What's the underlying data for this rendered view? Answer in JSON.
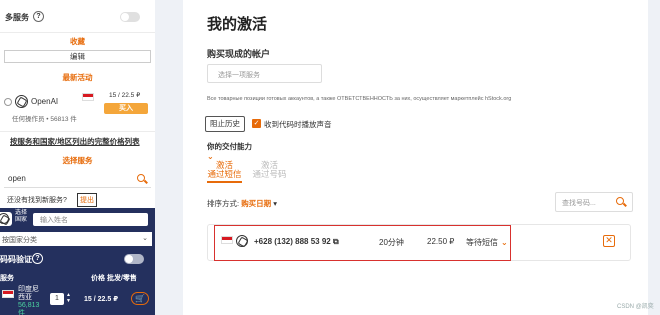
{
  "sidebar": {
    "multi_service_label": "多服务",
    "help_icon_text": "?",
    "favorites_label": "收藏",
    "edit_label": "编辑",
    "latest_activity_label": "最新活动",
    "latest_item": {
      "service": "OpenAI",
      "price_label": "15 / 22.5 ₽",
      "buy_label": "买入",
      "stock_label": "任何操作员 • 56813 件"
    },
    "full_price_link": "按服务和国家/地区列出的完整价格列表",
    "choose_service_label": "选择服务",
    "search_value": "open",
    "not_found_question": "还没有找到新服务?",
    "submit_label": "提出"
  },
  "dark_panel": {
    "small_label": "选择国家",
    "name_placeholder": "输入姓名",
    "country_placeholder": "按国家分类",
    "sms_label": "码码验证",
    "service_header": "服务",
    "price_header": "价格 批发/零售",
    "country_name": "印度尼西亚",
    "pieces_label": "56,813 件",
    "quantity": "1",
    "price_label": "15 / 22.5 ₽",
    "cart_icon": "cart-icon"
  },
  "main": {
    "title": "我的激活",
    "buy_ready_label": "购买现成的帐户",
    "service_placeholder": "选择一项服务",
    "disclaimer": "Все товарные позиции готовых аккаунтов, а также ОТВЕТСТВЕННОСТЬ за них, осуществляет маркетплейс hStock.org",
    "history_button": "阻止历史",
    "sound_checkbox_label": "收到代码时播放声音",
    "capability_label": "你的交付能力",
    "tabs": [
      {
        "line1": "激活",
        "line2": "通过短信"
      },
      {
        "line1": "激活",
        "line2": "通过号码"
      }
    ],
    "sort_label": "排序方式:",
    "sort_value": "购买日期",
    "number_search_placeholder": "查找号码...",
    "order": {
      "phone": "+628 (132) 888 53 92",
      "duration": "20分钟",
      "price": "22.50 ₽",
      "status": "等待短信"
    }
  },
  "watermark": "CSDN @凯奕",
  "colors": {
    "accent": "#e76b0a",
    "highlight": "#d8312e",
    "dark_panel": "#24305e",
    "pieces_green": "#4cd3a0"
  }
}
